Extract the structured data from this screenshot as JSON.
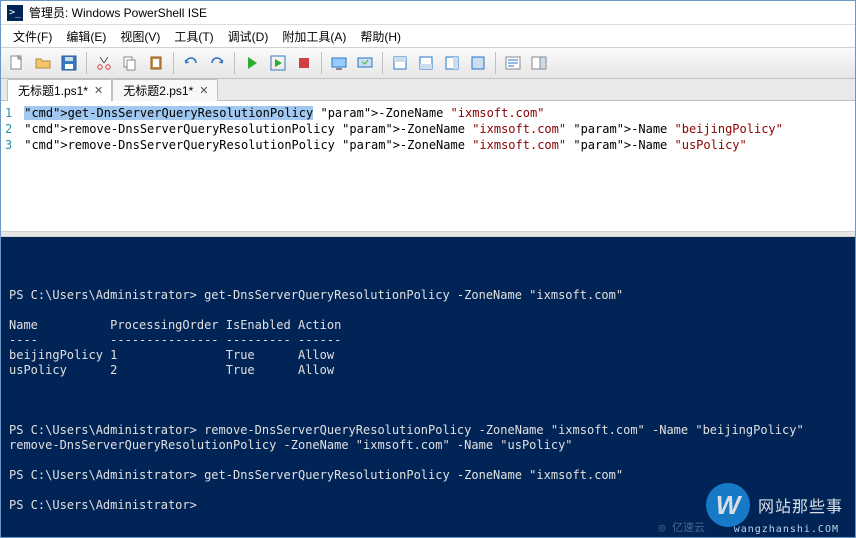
{
  "title": "管理员: Windows PowerShell ISE",
  "menu": [
    "文件(F)",
    "编辑(E)",
    "视图(V)",
    "工具(T)",
    "调试(D)",
    "附加工具(A)",
    "帮助(H)"
  ],
  "tabs": [
    {
      "label": "无标题1.ps1*",
      "active": true
    },
    {
      "label": "无标题2.ps1*",
      "active": false
    }
  ],
  "editor_lines": [
    {
      "n": "1",
      "text": "get-DnsServerQueryResolutionPolicy -ZoneName \"ixmsoft.com\"",
      "highlight": true
    },
    {
      "n": "2",
      "text": "remove-DnsServerQueryResolutionPolicy -ZoneName \"ixmsoft.com\" -Name \"beijingPolicy\""
    },
    {
      "n": "3",
      "text": "remove-DnsServerQueryResolutionPolicy -ZoneName \"ixmsoft.com\" -Name \"usPolicy\""
    }
  ],
  "console_lines": [
    "",
    "PS C:\\Users\\Administrator> get-DnsServerQueryResolutionPolicy -ZoneName \"ixmsoft.com\"",
    "",
    "Name          ProcessingOrder IsEnabled Action",
    "----          --------------- --------- ------",
    "beijingPolicy 1               True      Allow",
    "usPolicy      2               True      Allow",
    "",
    "",
    "",
    "PS C:\\Users\\Administrator> remove-DnsServerQueryResolutionPolicy -ZoneName \"ixmsoft.com\" -Name \"beijingPolicy\"",
    "remove-DnsServerQueryResolutionPolicy -ZoneName \"ixmsoft.com\" -Name \"usPolicy\"",
    "",
    "PS C:\\Users\\Administrator> get-DnsServerQueryResolutionPolicy -ZoneName \"ixmsoft.com\"",
    "",
    "PS C:\\Users\\Administrator> ",
    ""
  ],
  "watermark": {
    "badge": "W",
    "text": "网站那些事",
    "sub": "wangzhanshi.COM",
    "extra": "◎ 亿速云"
  }
}
